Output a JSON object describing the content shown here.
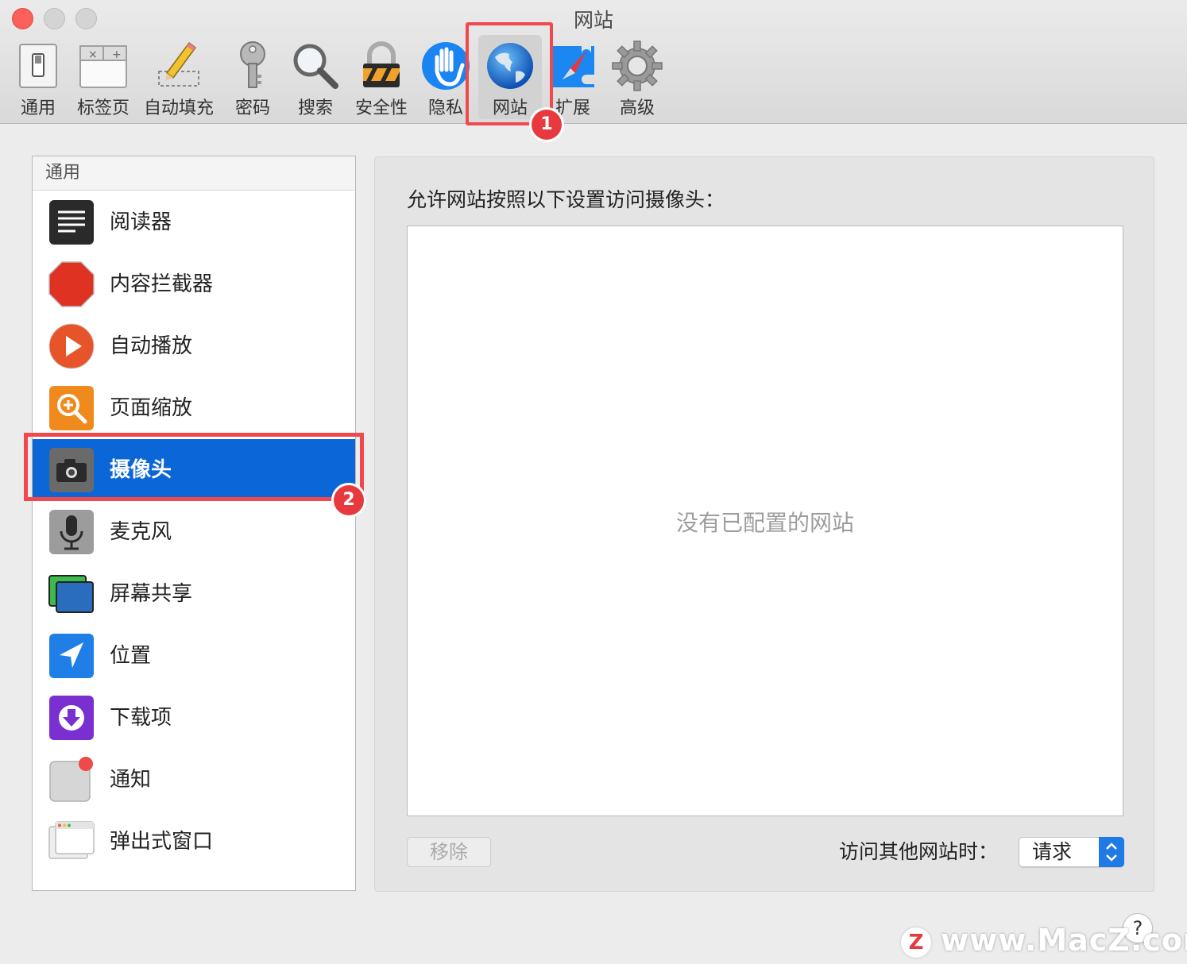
{
  "window": {
    "title": "网站"
  },
  "toolbar": {
    "items": [
      {
        "label": "通用",
        "icon": "switch-icon"
      },
      {
        "label": "标签页",
        "icon": "tabs-icon"
      },
      {
        "label": "自动填充",
        "icon": "pencil-icon"
      },
      {
        "label": "密码",
        "icon": "key-icon"
      },
      {
        "label": "搜索",
        "icon": "magnifier-icon"
      },
      {
        "label": "安全性",
        "icon": "padlock-icon"
      },
      {
        "label": "隐私",
        "icon": "hand-icon"
      },
      {
        "label": "网站",
        "icon": "globe-icon",
        "selected": true
      },
      {
        "label": "扩展",
        "icon": "puzzle-compass-icon"
      },
      {
        "label": "高级",
        "icon": "gear-icon"
      }
    ]
  },
  "annotations": {
    "badge1": "1",
    "badge2": "2"
  },
  "sidebar": {
    "header": "通用",
    "items": [
      {
        "label": "阅读器",
        "icon": "reader-icon"
      },
      {
        "label": "内容拦截器",
        "icon": "stop-sign-icon"
      },
      {
        "label": "自动播放",
        "icon": "play-icon"
      },
      {
        "label": "页面缩放",
        "icon": "zoom-icon"
      },
      {
        "label": "摄像头",
        "icon": "camera-icon",
        "selected": true
      },
      {
        "label": "麦克风",
        "icon": "microphone-icon"
      },
      {
        "label": "屏幕共享",
        "icon": "screen-share-icon"
      },
      {
        "label": "位置",
        "icon": "location-arrow-icon"
      },
      {
        "label": "下载项",
        "icon": "download-icon"
      },
      {
        "label": "通知",
        "icon": "notification-icon"
      },
      {
        "label": "弹出式窗口",
        "icon": "popup-window-icon"
      }
    ]
  },
  "main": {
    "heading": "允许网站按照以下设置访问摄像头：",
    "empty_message": "没有已配置的网站",
    "remove_button": "移除",
    "other_sites_label": "访问其他网站时：",
    "other_sites_value": "请求"
  },
  "help": {
    "label": "?"
  },
  "watermark": {
    "logo": "Z",
    "text": "www.MacZ.com"
  },
  "colors": {
    "accent": "#0b66d8",
    "annotation": "#f0484d",
    "close": "#fc605b"
  }
}
